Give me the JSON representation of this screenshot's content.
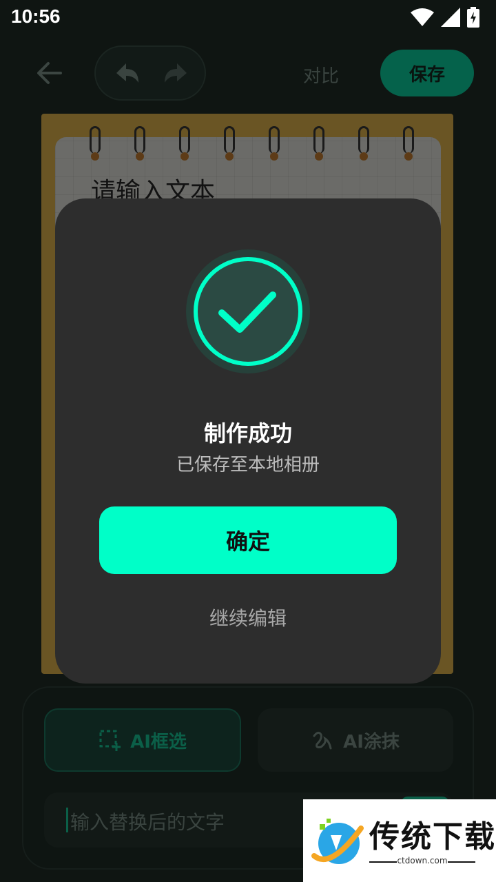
{
  "status_bar": {
    "time": "10:56"
  },
  "header": {
    "compare_label": "对比",
    "save_label": "保存"
  },
  "notebook": {
    "placeholder_text": "请输入文本"
  },
  "dialog": {
    "title": "制作成功",
    "subtitle": "已保存至本地相册",
    "confirm_label": "确定",
    "continue_label": "继续编辑"
  },
  "bottom_panel": {
    "mode_select_label": "AI框选",
    "mode_erase_label": "AI涂抹",
    "replace_placeholder": "输入替换后的文字"
  },
  "watermark": {
    "title": "传统下载",
    "url": "ctdown.com"
  },
  "icons": {
    "back": "arrow-left-icon",
    "undo": "undo-icon",
    "redo": "redo-icon",
    "success": "check-circle-icon",
    "select": "dashed-select-icon",
    "erase": "brush-squiggle-icon"
  },
  "colors": {
    "accent": "#00ffc8",
    "dialog_bg": "#2d2d2d",
    "save_button": "#05624b"
  }
}
